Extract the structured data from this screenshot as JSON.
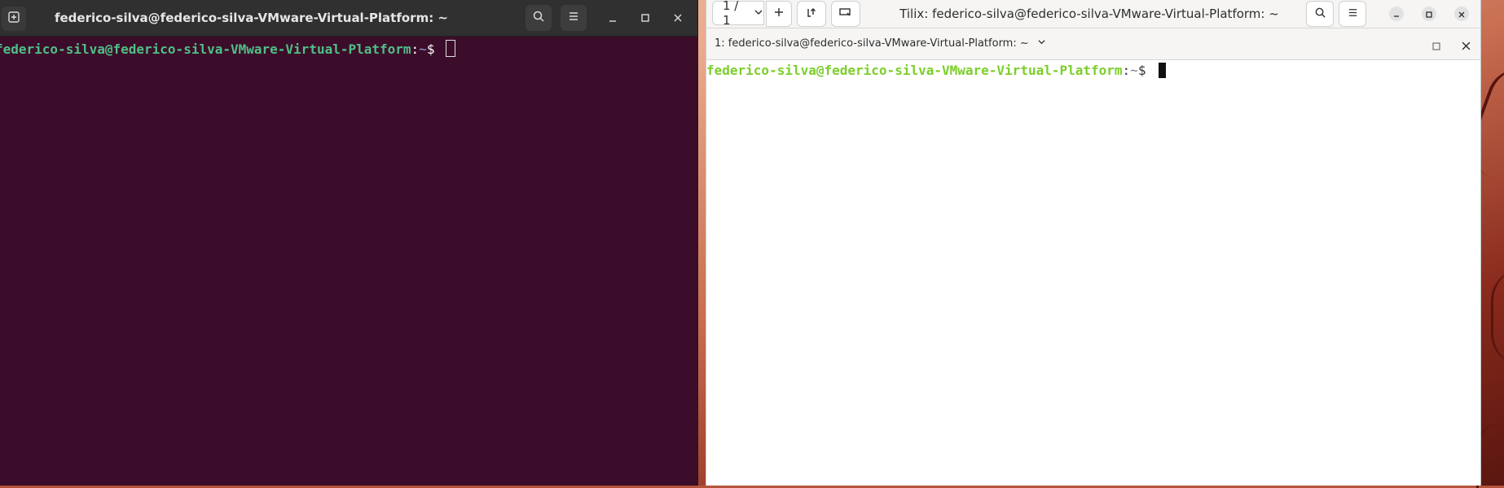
{
  "left_terminal": {
    "title": "federico-silva@federico-silva-VMware-Virtual-Platform: ~",
    "prompt": {
      "user_host": "federico-silva@federico-silva-VMware-Virtual-Platform",
      "separator": ":",
      "path": "~",
      "symbol": "$"
    },
    "icons": [
      "new-tab-icon",
      "search-icon",
      "menu-icon",
      "minimize-icon",
      "maximize-icon",
      "close-icon"
    ]
  },
  "tilix": {
    "session_label": "1 / 1",
    "title": "Tilix: federico-silva@federico-silva-VMware-Virtual-Platform: ~",
    "terminal_title": "1: federico-silva@federico-silva-VMware-Virtual-Platform: ~",
    "prompt": {
      "user_host": "federico-silva@federico-silva-VMware-Virtual-Platform",
      "separator": ":",
      "path": "~",
      "symbol": "$"
    },
    "icons": [
      "chevron-down-icon",
      "add-icon",
      "split-icon",
      "sync-input-icon",
      "search-icon",
      "menu-icon",
      "minimize-icon",
      "maximize-icon",
      "close-icon"
    ]
  },
  "colors": {
    "left_bg": "#3c0d2a",
    "left_prompt": "#4fbf86",
    "tilix_prompt": "#7bcf2a"
  }
}
